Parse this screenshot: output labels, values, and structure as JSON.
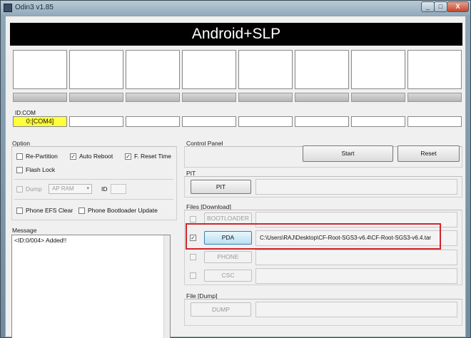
{
  "window": {
    "title": "Odin3 v1.85",
    "minimize": "_",
    "maximize": "□",
    "close": "X"
  },
  "banner": "Android+SLP",
  "idcom": {
    "label": "ID:COM",
    "ports": [
      "0:[COM4]",
      "",
      "",
      "",
      "",
      "",
      "",
      ""
    ]
  },
  "option": {
    "title": "Option",
    "re_partition": "Re-Partition",
    "auto_reboot": "Auto Reboot",
    "f_reset_time": "F. Reset Time",
    "flash_lock": "Flash Lock",
    "dump": "Dump",
    "dump_target": "AP RAM",
    "id_label": "ID",
    "phone_efs_clear": "Phone EFS Clear",
    "phone_bootloader_update": "Phone Bootloader Update",
    "check_mark": "✓",
    "combo_arrow": "▾"
  },
  "message": {
    "title": "Message",
    "log": "<ID:0/004> Added!!"
  },
  "control_panel": {
    "title": "Control Panel",
    "start": "Start",
    "reset": "Reset"
  },
  "pit": {
    "title": "PIT",
    "button": "PIT"
  },
  "files": {
    "title": "Files [Download]",
    "bootloader": "BOOTLOADER",
    "pda": "PDA",
    "pda_path": "C:\\Users\\RAJ\\Desktop\\CF-Root-SGS3-v6.4\\CF-Root-SGS3-v6.4.tar",
    "phone": "PHONE",
    "csc": "CSC"
  },
  "file_dump": {
    "title": "File [Dump]",
    "button": "DUMP"
  },
  "colors": {
    "active_port": "#ffff3a",
    "highlight": "#d1252a",
    "banner_bg": "#000000"
  }
}
